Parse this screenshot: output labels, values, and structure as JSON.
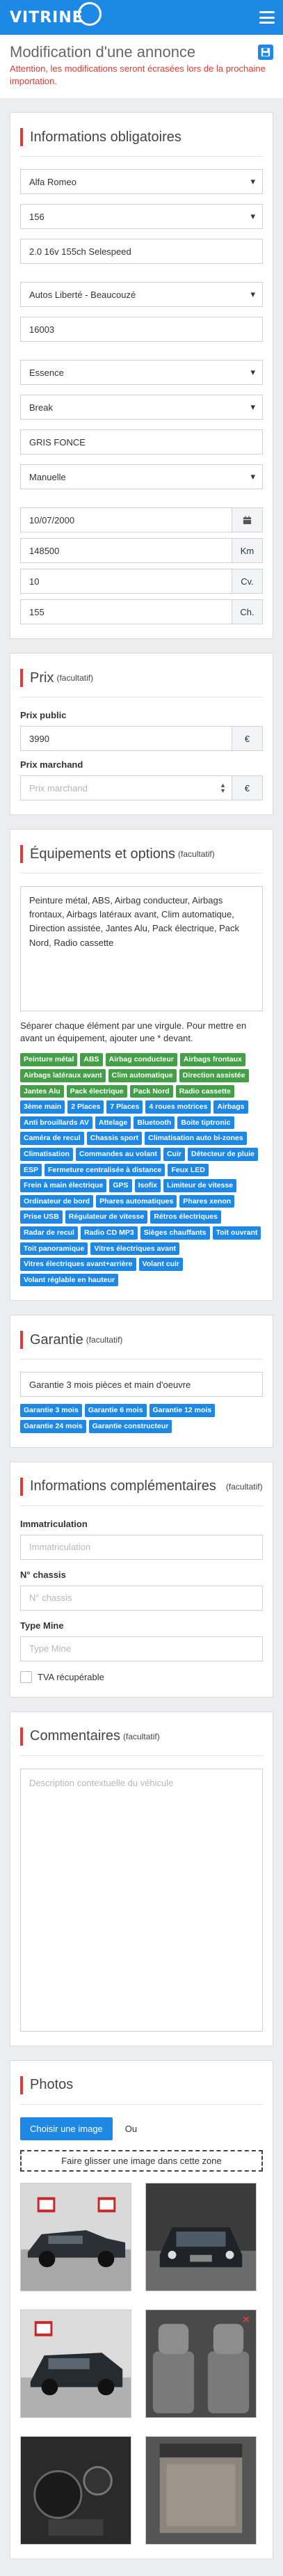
{
  "nav": {
    "logo_text": "VITRINE",
    "accent": "#1e88e5"
  },
  "header": {
    "title": "Modification d'une annonce",
    "warning": "Attention, les modifications seront écrasées lors de la prochaine importation."
  },
  "infos": {
    "title": "Informations obligatoires",
    "marque": "Alfa Romeo",
    "modele": "156",
    "version": "2.0 16v 155ch Selespeed",
    "vendeur": "Autos Liberté - Beaucouzé",
    "code_postal": "16003",
    "energie": "Essence",
    "carrosserie": "Break",
    "couleur": "GRIS FONCE",
    "boite": "Manuelle",
    "date": "10/07/2000",
    "km": "148500",
    "km_unit": "Km",
    "cv": "10",
    "cv_unit": "Cv.",
    "ch": "155",
    "ch_unit": "Ch."
  },
  "prix": {
    "title": "Prix",
    "optional": "(facultatif)",
    "public_label": "Prix public",
    "public_value": "3990",
    "currency": "€",
    "marchand_label": "Prix marchand",
    "marchand_placeholder": "Prix marchand"
  },
  "equipements": {
    "title": "Équipements et options",
    "optional": "(facultatif)",
    "text": "Peinture métal, ABS, Airbag conducteur, Airbags frontaux, Airbags latéraux avant, Clim automatique, Direction assistée, Jantes Alu, Pack électrique, Pack Nord, Radio cassette",
    "help": "Séparer chaque élément par une virgule. Pour mettre en avant un équipement, ajouter une * devant.",
    "tags": [
      {
        "label": "Peinture métal",
        "color": "green"
      },
      {
        "label": "ABS",
        "color": "green"
      },
      {
        "label": "Airbag conducteur",
        "color": "green"
      },
      {
        "label": "Airbags frontaux",
        "color": "green"
      },
      {
        "label": "Airbags latéraux avant",
        "color": "green"
      },
      {
        "label": "Clim automatique",
        "color": "green"
      },
      {
        "label": "Direction assistée",
        "color": "green"
      },
      {
        "label": "Jantes Alu",
        "color": "green"
      },
      {
        "label": "Pack électrique",
        "color": "green"
      },
      {
        "label": "Pack Nord",
        "color": "green"
      },
      {
        "label": "Radio cassette",
        "color": "green"
      },
      {
        "label": "3ème main",
        "color": "blue"
      },
      {
        "label": "2 Places",
        "color": "blue"
      },
      {
        "label": "7 Places",
        "color": "blue"
      },
      {
        "label": "4 roues motrices",
        "color": "blue"
      },
      {
        "label": "Airbags",
        "color": "blue"
      },
      {
        "label": "Anti brouillards AV",
        "color": "blue"
      },
      {
        "label": "Attelage",
        "color": "blue"
      },
      {
        "label": "Bluetooth",
        "color": "blue"
      },
      {
        "label": "Boite tiptronic",
        "color": "blue"
      },
      {
        "label": "Caméra de recul",
        "color": "blue"
      },
      {
        "label": "Chassis sport",
        "color": "blue"
      },
      {
        "label": "Climatisation auto bi-zones",
        "color": "blue"
      },
      {
        "label": "Climatisation",
        "color": "blue"
      },
      {
        "label": "Commandes au volant",
        "color": "blue"
      },
      {
        "label": "Cuir",
        "color": "blue"
      },
      {
        "label": "Détecteur de pluie",
        "color": "blue"
      },
      {
        "label": "ESP",
        "color": "blue"
      },
      {
        "label": "Fermeture centralisée à distance",
        "color": "blue"
      },
      {
        "label": "Feux LED",
        "color": "blue"
      },
      {
        "label": "Frein à main électrique",
        "color": "blue"
      },
      {
        "label": "GPS",
        "color": "blue"
      },
      {
        "label": "Isofix",
        "color": "blue"
      },
      {
        "label": "Limiteur de vitesse",
        "color": "blue"
      },
      {
        "label": "Ordinateur de bord",
        "color": "blue"
      },
      {
        "label": "Phares automatiques",
        "color": "blue"
      },
      {
        "label": "Phares xenon",
        "color": "blue"
      },
      {
        "label": "Prise USB",
        "color": "blue"
      },
      {
        "label": "Régulateur de vitesse",
        "color": "blue"
      },
      {
        "label": "Rétros électriques",
        "color": "blue"
      },
      {
        "label": "Radar de recul",
        "color": "blue"
      },
      {
        "label": "Radio CD MP3",
        "color": "blue"
      },
      {
        "label": "Sièges chauffants",
        "color": "blue"
      },
      {
        "label": "Toit ouvrant",
        "color": "blue"
      },
      {
        "label": "Toit panoramique",
        "color": "blue"
      },
      {
        "label": "Vitres électriques avant",
        "color": "blue"
      },
      {
        "label": "Vitres électriques avant+arrière",
        "color": "blue"
      },
      {
        "label": "Volant cuir",
        "color": "blue"
      },
      {
        "label": "Volant réglable en hauteur",
        "color": "blue"
      }
    ]
  },
  "garantie": {
    "title": "Garantie",
    "optional": "(facultatif)",
    "value": "Garantie 3 mois pièces et main d'oeuvre",
    "tags": [
      "Garantie 3 mois",
      "Garantie 6 mois",
      "Garantie 12 mois",
      "Garantie 24 mois",
      "Garantie constructeur"
    ]
  },
  "complementaires": {
    "title": "Informations complémentaires",
    "optional": "(facultatif)",
    "immat_label": "Immatriculation",
    "immat_placeholder": "Immatriculation",
    "chassis_label": "N° chassis",
    "chassis_placeholder": "N° chassis",
    "type_mine_label": "Type Mine",
    "type_mine_placeholder": "Type Mine",
    "tva_label": "TVA récupérable"
  },
  "commentaires": {
    "title": "Commentaires",
    "optional": "(facultatif)",
    "placeholder": "Description contextuelle du véhicule"
  },
  "photos": {
    "title": "Photos",
    "choose_label": "Choisir une image",
    "or_label": "Ou",
    "drop_label": "Faire glisser une image dans cette zone",
    "items": [
      {
        "name": "photo-exterior-front-side"
      },
      {
        "name": "photo-exterior-front"
      },
      {
        "name": "photo-exterior-rear"
      },
      {
        "name": "photo-interior-seats"
      },
      {
        "name": "photo-dashboard"
      },
      {
        "name": "photo-trunk"
      }
    ]
  }
}
